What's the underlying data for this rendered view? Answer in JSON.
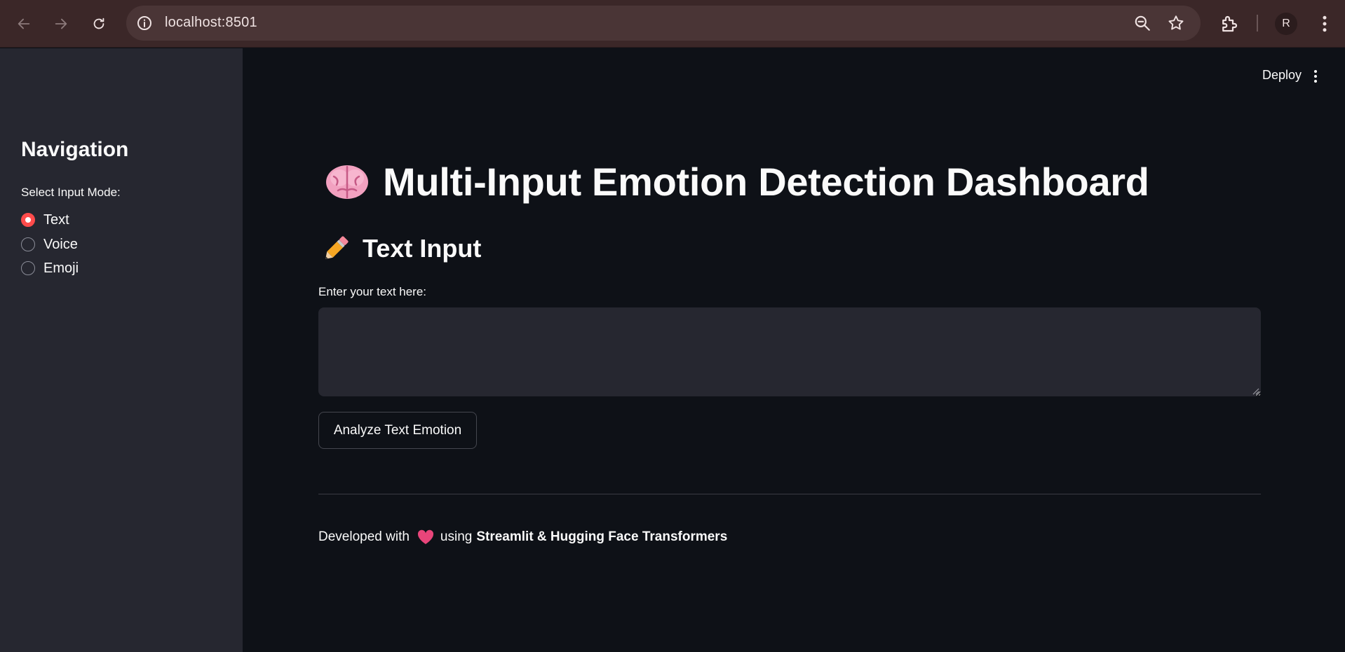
{
  "browser": {
    "url": "localhost:8501",
    "profile_initial": "R"
  },
  "sidebar": {
    "heading": "Navigation",
    "radio_label": "Select Input Mode:",
    "options": [
      {
        "label": "Text",
        "checked": true
      },
      {
        "label": "Voice",
        "checked": false
      },
      {
        "label": "Emoji",
        "checked": false
      }
    ]
  },
  "header": {
    "deploy_label": "Deploy"
  },
  "main": {
    "title": "Multi-Input Emotion Detection Dashboard",
    "title_icon": "brain-icon",
    "subheader": "Text Input",
    "subheader_icon": "pencil-icon",
    "text_label": "Enter your text here:",
    "text_value": "",
    "button_label": "Analyze Text Emotion",
    "footer_prefix": "Developed with",
    "footer_icon": "heart-icon",
    "footer_using": "using",
    "footer_bold": "Streamlit & Hugging Face Transformers"
  },
  "colors": {
    "accent": "#ff4b4b",
    "background": "#0e1117",
    "sidebar_bg": "#262730",
    "chrome_bg": "#3b2728"
  }
}
